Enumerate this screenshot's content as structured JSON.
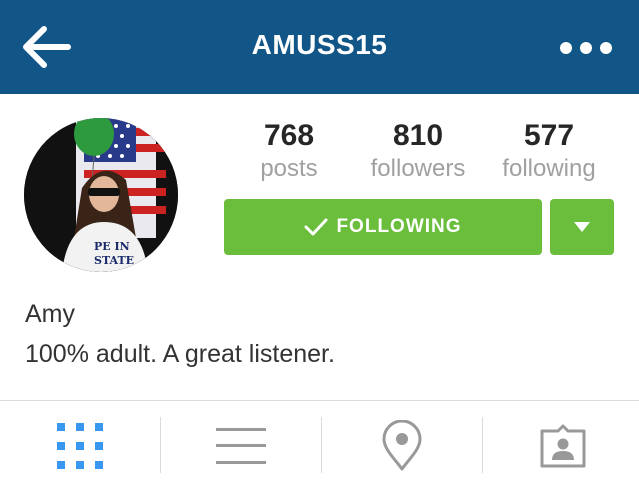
{
  "header": {
    "title": "AMUSS15",
    "background_color": "#125688",
    "back_icon": "arrow-left-icon",
    "more_icon": "more-horizontal-icon"
  },
  "profile": {
    "stats": [
      {
        "value": "768",
        "label": "posts"
      },
      {
        "value": "810",
        "label": "followers"
      },
      {
        "value": "577",
        "label": "following"
      }
    ],
    "follow_button": {
      "label": "FOLLOWING",
      "icon": "check-icon",
      "color": "#6bbd3c"
    },
    "dropdown_icon": "caret-down-icon",
    "name": "Amy",
    "bio": "100% adult. A great listener."
  },
  "tabs": [
    {
      "icon": "grid-icon",
      "active": true
    },
    {
      "icon": "list-icon",
      "active": false
    },
    {
      "icon": "location-pin-icon",
      "active": false
    },
    {
      "icon": "tagged-user-icon",
      "active": false
    }
  ],
  "colors": {
    "accent_blue": "#3897f0",
    "inactive_icon": "#999999"
  }
}
